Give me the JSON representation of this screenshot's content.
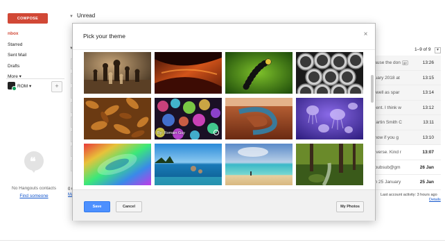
{
  "sidebar": {
    "compose_label": "COMPOSE",
    "items": [
      {
        "label": "nbox",
        "active": true
      },
      {
        "label": "Starred"
      },
      {
        "label": "Sent Mail"
      },
      {
        "label": "Drafts"
      },
      {
        "label": "More ▾"
      }
    ],
    "hangouts_user": "ROM ▾",
    "add_label": "+",
    "no_hangouts": "No Hangouts contacts",
    "find_someone": "Find someone"
  },
  "main": {
    "section_title": "Unread",
    "page_count": "1–9 of 9",
    "emails": [
      {
        "snippet": "cause the don",
        "time": "13:26",
        "badge": "gp",
        "read": false
      },
      {
        "snippet": "nuary 2018 at",
        "time": "13:15",
        "read": false
      },
      {
        "snippet": "s well as spar",
        "time": "13:14",
        "read": false
      },
      {
        "snippet": "ment. I think w",
        "time": "13:12",
        "read": false
      },
      {
        "snippet": "Martin Smith C",
        "time": "13:11",
        "read": false
      },
      {
        "snippet": "know if you g",
        "time": "13:10",
        "read": false
      },
      {
        "snippet": "e verse. Kind r",
        "time": "13:07",
        "read": true,
        "bold": true
      },
      {
        "snippet": "npubsub@gm",
        "time": "26 Jan",
        "read": true,
        "bold": true
      },
      {
        "snippet": "on 25 January",
        "time": "25 Jan",
        "read": true,
        "bold": true
      }
    ],
    "fragment_a": "0 G",
    "fragment_b": "Ma",
    "last_activity": "Last account activity: 3 hours ago",
    "details": "Details"
  },
  "dialog": {
    "title": "Pick your theme",
    "close": "×",
    "credit": "By: Romain Guy",
    "save_label": "Save",
    "cancel_label": "Cancel",
    "my_photos_label": "My Photos"
  },
  "themes": [
    {
      "name": "chess-theme"
    },
    {
      "name": "canyon-arch-theme"
    },
    {
      "name": "caterpillar-theme"
    },
    {
      "name": "pipes-theme"
    },
    {
      "name": "autumn-leaves-theme"
    },
    {
      "name": "bokeh-lights-theme"
    },
    {
      "name": "horseshoe-bend-theme"
    },
    {
      "name": "jellyfish-theme"
    },
    {
      "name": "rainbow-swirl-theme"
    },
    {
      "name": "lake-tahoe-theme"
    },
    {
      "name": "beach-theme"
    },
    {
      "name": "forest-stream-theme"
    }
  ],
  "colors": {
    "accent_red": "#d14836",
    "save_blue": "#4d90fe",
    "link_blue": "#1155cc"
  }
}
